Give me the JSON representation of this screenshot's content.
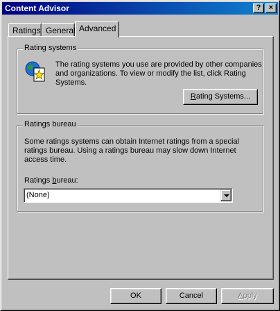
{
  "window": {
    "title": "Content Advisor",
    "help_button": "?",
    "close_button": "×"
  },
  "tabs": [
    {
      "label": "Ratings",
      "selected": false
    },
    {
      "label": "General",
      "selected": false
    },
    {
      "label": "Advanced",
      "selected": true
    }
  ],
  "rating_systems": {
    "group_label": "Rating systems",
    "icon": "globe-document-star-icon",
    "description_lines": [
      "The rating systems you use are provided by other companies",
      "and organizations. To view or modify the list, click Rating",
      "Systems."
    ],
    "button": {
      "accel": "R",
      "rest": "ating Systems..."
    }
  },
  "ratings_bureau": {
    "group_label": "Ratings bureau",
    "description_lines": [
      "Some ratings systems can obtain Internet ratings from a special",
      "ratings bureau. Using a ratings bureau may slow down Internet",
      "access time."
    ],
    "field_label": {
      "before": "Ratings ",
      "accel": "b",
      "after": "ureau:"
    },
    "selected_value": "(None)"
  },
  "footer": {
    "ok_label": "OK",
    "cancel_label": "Cancel",
    "apply": {
      "accel": "A",
      "rest": "pply"
    }
  }
}
